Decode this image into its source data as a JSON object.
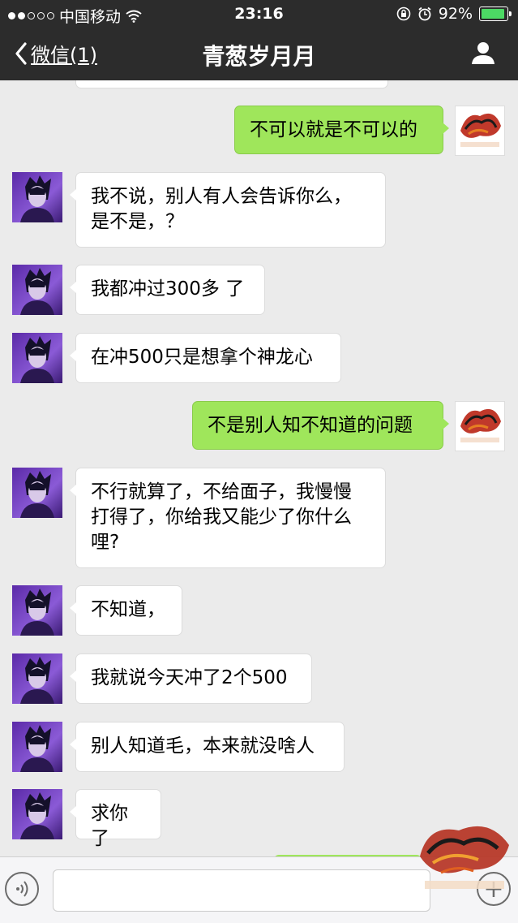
{
  "status_bar": {
    "carrier": "中国移动",
    "time": "23:16",
    "battery": "92%",
    "battery_level": 0.92,
    "signal_bars": 2,
    "icons": [
      "signal-dots-icon",
      "wifi-icon",
      "rotation-lock-icon",
      "alarm-icon",
      "battery-icon"
    ]
  },
  "nav": {
    "back_label": "微信(1)",
    "title": "青葱岁月月",
    "icons": [
      "back-chevron-icon",
      "profile-icon"
    ]
  },
  "messages": [
    {
      "side": "right",
      "text": "不可以就是不可以的"
    },
    {
      "side": "left",
      "text": "我不说，别人有人会告诉你么，\n是不是，？"
    },
    {
      "side": "left",
      "text": "我都冲过300多 了"
    },
    {
      "side": "left",
      "text": "在冲500只是想拿个神龙心"
    },
    {
      "side": "right",
      "text": "不是别人知不知道的问题"
    },
    {
      "side": "left",
      "text": "不行就算了，不给面子，我慢慢\n打得了，你给我又能少了你什么\n哩?"
    },
    {
      "side": "left",
      "text": "不知道，"
    },
    {
      "side": "left",
      "text": "我就说今天冲了2个500"
    },
    {
      "side": "left",
      "text": "别人知道毛，本来就没啥人"
    },
    {
      "side": "left",
      "text": "求你了"
    }
  ],
  "input_bar": {
    "icons": [
      "voice-icon",
      "add-icon"
    ]
  },
  "colors": {
    "nav_bg": "#2c2c2c",
    "chat_bg": "#ebebeb",
    "sent_bubble": "#9fe65b",
    "received_bubble": "#ffffff"
  }
}
